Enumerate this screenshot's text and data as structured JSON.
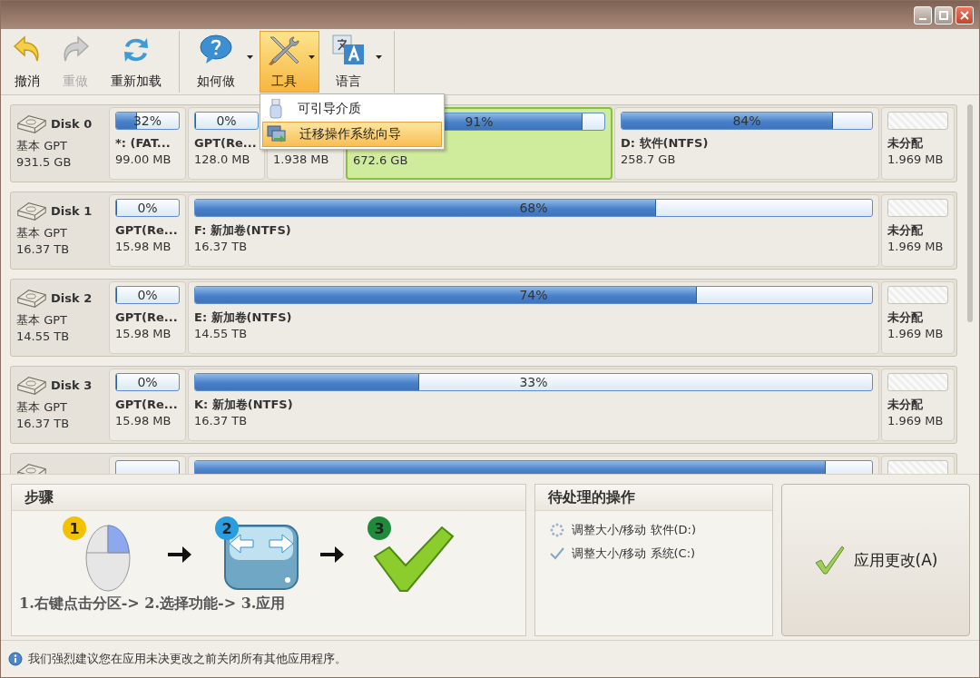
{
  "toolbar": [
    {
      "kind": "undo",
      "label": "撤消",
      "disabled": false,
      "dropdown": false,
      "selected": false
    },
    {
      "kind": "redo",
      "label": "重做",
      "disabled": true,
      "dropdown": false,
      "selected": false
    },
    {
      "kind": "reload",
      "label": "重新加载",
      "disabled": false,
      "dropdown": false,
      "selected": false
    },
    {
      "kind": "help",
      "label": "如何做",
      "disabled": false,
      "dropdown": true,
      "selected": false
    },
    {
      "kind": "tools",
      "label": "工具",
      "disabled": false,
      "dropdown": true,
      "selected": true
    },
    {
      "kind": "language",
      "label": "语言",
      "disabled": false,
      "dropdown": true,
      "selected": false
    }
  ],
  "menu": {
    "items": [
      {
        "kind": "usb",
        "label": "可引导介质",
        "selected": false
      },
      {
        "kind": "migrate",
        "label": "迁移操作系统向导",
        "selected": true
      }
    ]
  },
  "disks": [
    {
      "name": "Disk 0",
      "type": "基本 GPT",
      "size": "931.5 GB",
      "partitions": [
        {
          "kind": "small",
          "level": 0.32,
          "percent": "32%",
          "name": "*: (FAT...",
          "size": "99.00 MB",
          "selected": false
        },
        {
          "kind": "small",
          "level": 0,
          "percent": "0%",
          "name": "GPT(Re...",
          "size": "128.0 MB",
          "selected": false
        },
        {
          "kind": "small",
          "size": "1.938 MB",
          "selected": false
        },
        {
          "kind": "large",
          "level": 0.91,
          "percent": "91%",
          "size": "672.6 GB",
          "selected": true
        },
        {
          "kind": "large",
          "level": 0.84,
          "percent": "84%",
          "name": "D: 软件(NTFS)",
          "size": "258.7 GB",
          "selected": false
        },
        {
          "kind": "unallocated",
          "name": "未分配",
          "size": "1.969 MB",
          "selected": false
        }
      ]
    },
    {
      "name": "Disk 1",
      "type": "基本 GPT",
      "size": "16.37 TB",
      "partitions": [
        {
          "kind": "small",
          "level": 0,
          "percent": "0%",
          "name": "GPT(Re...",
          "size": "15.98 MB",
          "selected": false
        },
        {
          "kind": "large",
          "level": 0.68,
          "percent": "68%",
          "name": "F: 新加卷(NTFS)",
          "size": "16.37 TB",
          "selected": false
        },
        {
          "kind": "unallocated",
          "name": "未分配",
          "size": "1.969 MB",
          "selected": false
        }
      ]
    },
    {
      "name": "Disk 2",
      "type": "基本 GPT",
      "size": "14.55 TB",
      "partitions": [
        {
          "kind": "small",
          "level": 0,
          "percent": "0%",
          "name": "GPT(Re...",
          "size": "15.98 MB",
          "selected": false
        },
        {
          "kind": "large",
          "level": 0.74,
          "percent": "74%",
          "name": "E: 新加卷(NTFS)",
          "size": "14.55 TB",
          "selected": false
        },
        {
          "kind": "unallocated",
          "name": "未分配",
          "size": "1.969 MB",
          "selected": false
        }
      ]
    },
    {
      "name": "Disk 3",
      "type": "基本 GPT",
      "size": "16.37 TB",
      "partitions": [
        {
          "kind": "small",
          "level": 0,
          "percent": "0%",
          "name": "GPT(Re...",
          "size": "15.98 MB",
          "selected": false
        },
        {
          "kind": "large",
          "level": 0.33,
          "percent": "33%",
          "name": "K: 新加卷(NTFS)",
          "size": "16.37 TB",
          "selected": false
        },
        {
          "kind": "unallocated",
          "name": "未分配",
          "size": "1.969 MB",
          "selected": false
        }
      ]
    },
    {
      "partitions": [
        {
          "kind": "small",
          "selected": false
        },
        {
          "kind": "large",
          "level": 0.93,
          "selected": false
        },
        {
          "kind": "unallocated",
          "selected": false
        }
      ]
    }
  ],
  "steps": {
    "title": "步骤",
    "items": [
      {
        "kind": "mouse",
        "number": "1",
        "color": "#f2c200"
      },
      {
        "kind": "disk",
        "number": "2",
        "color": "#2a9de0"
      },
      {
        "kind": "check",
        "number": "3",
        "color": "#1f8a3a"
      }
    ],
    "caption": "1.右键点击分区-> 2.选择功能-> 3.应用"
  },
  "pending": {
    "title": "待处理的操作",
    "items": [
      {
        "kind": "pending",
        "text": "调整大小/移动 软件(D:)"
      },
      {
        "kind": "done",
        "text": "调整大小/移动 系统(C:)"
      }
    ]
  },
  "apply_button": {
    "label": "应用更改(A)"
  },
  "status_bar": {
    "text": "我们强烈建议您在应用未决更改之前关闭所有其他应用程序。"
  }
}
